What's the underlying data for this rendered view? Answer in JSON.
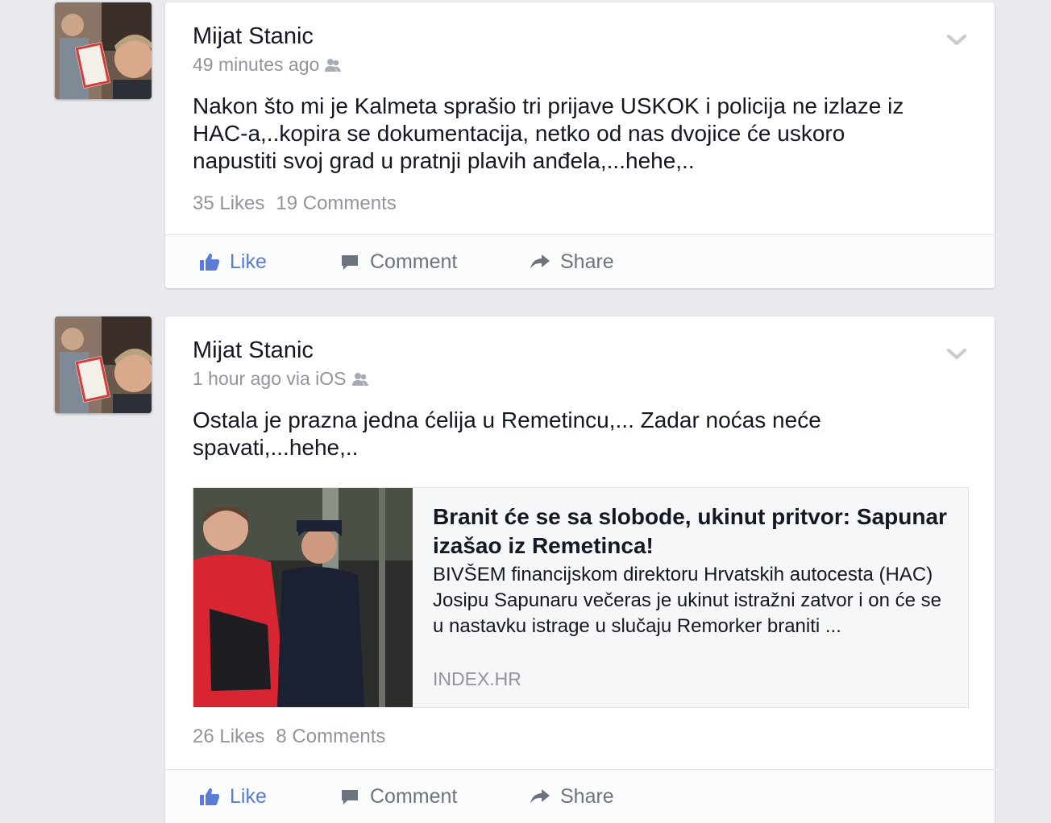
{
  "posts": [
    {
      "author": "Mijat Stanic",
      "time": "49 minutes ago",
      "text": "Nakon što mi je Kalmeta sprašio tri prijave USKOK i policija ne izlaze iz\nHAC-a,..kopira se dokumentacija, netko od nas dvojice će uskoro\nnapustiti svoj grad u pratnji plavih anđela,...hehe,..",
      "likes": "35 Likes",
      "comments": "19 Comments"
    },
    {
      "author": "Mijat Stanic",
      "time": "1 hour ago via iOS",
      "text": "Ostala je prazna jedna ćelija u Remetincu,... Zadar noćas neće\nspavati,...hehe,..",
      "link": {
        "title": "Branit će se sa slobode, ukinut pritvor: Sapunar izašao iz Remetinca!",
        "description": "BIVŠEM financijskom direktoru Hrvatskih autocesta (HAC) Josipu Sapunaru večeras je ukinut istražni zatvor i on će se u nastavku istrage u slučaju Remorker braniti ...",
        "source": "INDEX.HR"
      },
      "likes": "26 Likes",
      "comments": "8 Comments"
    }
  ],
  "actions": {
    "like": "Like",
    "comment": "Comment",
    "share": "Share"
  },
  "icons": {
    "like": "thumbs-up-icon",
    "comment": "speech-bubble-icon",
    "share": "share-arrow-icon",
    "audience": "friends-icon",
    "menu": "chevron-down-icon"
  },
  "colors": {
    "like_accent": "#5b7bd5",
    "muted": "#90949c",
    "background": "#e9eaee"
  }
}
